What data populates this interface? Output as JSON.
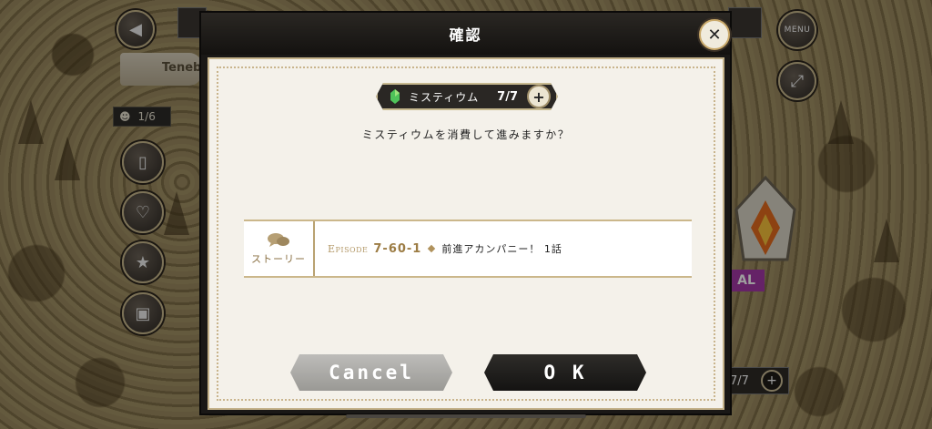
{
  "background": {
    "area_label": "Teneb",
    "party_count": "1/6",
    "menu_label": "MENU",
    "node_tag": "AL",
    "right_counter": "7/7"
  },
  "dialog": {
    "title": "確認",
    "currency": {
      "name": "ミスティウム",
      "count": "7/7",
      "icon": "gem-icon"
    },
    "question": "ミスティウムを消費して進みますか？",
    "story": {
      "tag_label": "ストーリー",
      "episode_prefix": "Episode",
      "episode_number": "7-60-1",
      "episode_title": "前進アカンパニー！ 1話"
    },
    "buttons": {
      "cancel": "Cancel",
      "ok": "O K"
    }
  },
  "colors": {
    "accent_gold": "#c9a96a",
    "panel_bg": "#f4f1ea",
    "tag_purple": "#a437a6"
  }
}
